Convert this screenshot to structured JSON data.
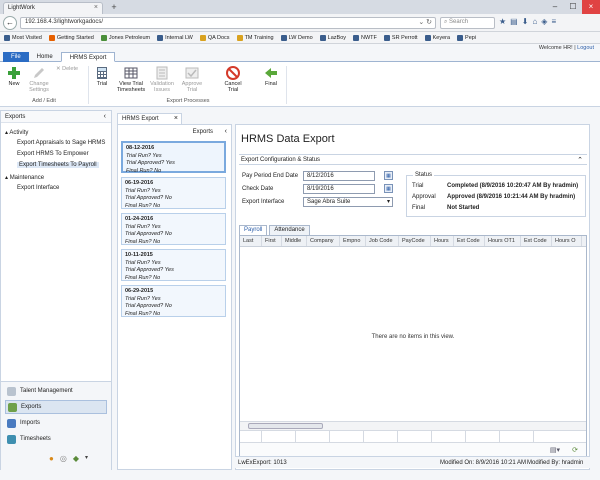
{
  "browser": {
    "tab_title": "LightWork",
    "new_tab": "+",
    "url": "192.168.4.3/lightworkgadocs/",
    "search_placeholder": "Search",
    "bookmarks": [
      {
        "label": "Most Visited",
        "color": "#3a5d8c"
      },
      {
        "label": "Getting Started",
        "color": "#e66000"
      },
      {
        "label": "Jones Petroleum",
        "color": "#4a8f3a"
      },
      {
        "label": "Internal LW",
        "color": "#3a5d8c"
      },
      {
        "label": "QA Docs",
        "color": "#d9a21f"
      },
      {
        "label": "TM Training",
        "color": "#d9a21f"
      },
      {
        "label": "LW Demo",
        "color": "#3a5d8c"
      },
      {
        "label": "LazBoy",
        "color": "#3a5d8c"
      },
      {
        "label": "NWTF",
        "color": "#3a5d8c"
      },
      {
        "label": "SR Perrott",
        "color": "#3a5d8c"
      },
      {
        "label": "Keyera",
        "color": "#3a5d8c"
      },
      {
        "label": "Pepi",
        "color": "#3a5d8c"
      }
    ]
  },
  "header": {
    "welcome": "Welcome HR!",
    "separator": "|",
    "logout": "Logout"
  },
  "app_tabs": {
    "file": "File",
    "home": "Home",
    "hrms_export": "HRMS Export"
  },
  "ribbon": {
    "add": "New",
    "change_settings": "Change Settings",
    "delete": "Delete",
    "group_add_edit": "Add / Edit",
    "trial": "Trial",
    "view_trial_timesheets": "View Trial Timesheets",
    "validation_issues": "Validation Issues",
    "approve_trial": "Approve Trial",
    "cancel_trial": "Cancel Trial",
    "final": "Final",
    "group_export_processes": "Export Processes"
  },
  "left_panel": {
    "title": "Exports",
    "activity": "Activity",
    "activity_items": [
      "Export Appraisals to Sage HRMS",
      "Export HRMS To Empower",
      "Export Timesheets To Payroll"
    ],
    "maintenance": "Maintenance",
    "maintenance_items": [
      "Export Interface"
    ],
    "nav": [
      "Talent Management",
      "Exports",
      "Imports",
      "Timesheets"
    ]
  },
  "doc_tab": "HRMS Export",
  "export_list": {
    "title": "Exports",
    "cards": [
      {
        "date": "08-12-2016",
        "run": "Trial Run? Yes",
        "approved": "Trial Approved? Yes",
        "final": "Final Run? No"
      },
      {
        "date": "06-19-2016",
        "run": "Trial Run? Yes",
        "approved": "Trial Approved? No",
        "final": "Final Run? No"
      },
      {
        "date": "01-24-2016",
        "run": "Trial Run? Yes",
        "approved": "Trial Approved? No",
        "final": "Final Run? No"
      },
      {
        "date": "10-11-2015",
        "run": "Trial Run? Yes",
        "approved": "Trial Approved? Yes",
        "final": "Final Run? No"
      },
      {
        "date": "06-29-2015",
        "run": "Trial Run? Yes",
        "approved": "Trial Approved? No",
        "final": "Final Run? No"
      }
    ]
  },
  "main": {
    "title": "HRMS Data Export",
    "config_section": "Export Configuration & Status",
    "pay_period_label": "Pay Period End Date",
    "pay_period_value": "8/12/2016",
    "check_date_label": "Check Date",
    "check_date_value": "8/19/2016",
    "interface_label": "Export Interface",
    "interface_value": "Sage Abra Suite",
    "status": {
      "legend": "Status",
      "trial_label": "Trial",
      "trial_value": "Completed (8/9/2016 10:20:47 AM By hradmin)",
      "approval_label": "Approval",
      "approval_value": "Approved (8/9/2016 10:21:44 AM By hradmin)",
      "final_label": "Final",
      "final_value": "Not Started"
    },
    "grid_tabs": [
      "Payroll",
      "Attendance"
    ],
    "columns": [
      "Last",
      "First",
      "Middle",
      "Company",
      "Empno",
      "Job Code",
      "PayCode",
      "Hours",
      "Ext Code",
      "Hours OT1",
      "Ext Code",
      "Hours O"
    ],
    "empty_text": "There are no items in this view."
  },
  "status_bar": {
    "id": "LwExExport: 1013",
    "modified_on": "Modified On: 8/9/2016 10:21 AM",
    "modified_by": "Modified By: hradmin"
  }
}
